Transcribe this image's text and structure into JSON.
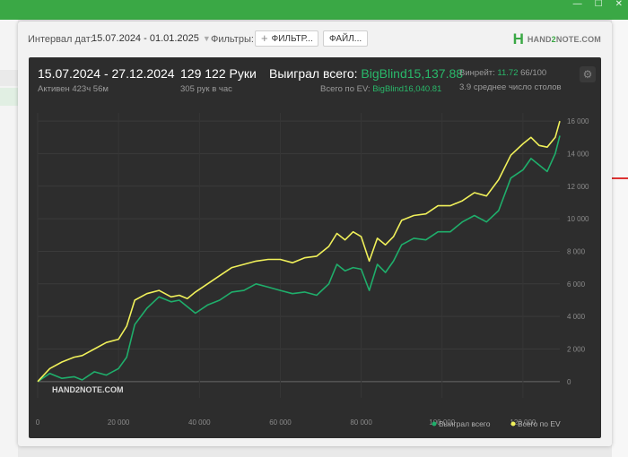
{
  "window": {
    "controls": [
      "—",
      "☐",
      "✕"
    ]
  },
  "filter_bar": {
    "interval_label": "Интервал дат:",
    "interval_value": "15.07.2024 - 01.01.2025",
    "filters_label": "Фильтры:",
    "filter_button": "ФИЛЬТР...",
    "file_button": "ФАЙЛ...",
    "logo_prefix": "HAND",
    "logo_number": "2",
    "logo_suffix": "NOTE.COM"
  },
  "stats": {
    "date_range": "15.07.2024 - 27.12.2024",
    "active": "Активен 423ч 56м",
    "hands": "129 122 Руки",
    "hands_per_hour": "305 рук в час",
    "won_label": "Выиграл всего:",
    "won_value": "BigBlind15,137.88",
    "ev_label": "Всего по EV:",
    "ev_value": "BigBlind16,040.81",
    "winrate_label": "Винрейт:",
    "winrate_value": "11.72",
    "winrate_per": "66/100",
    "avg_tables": "3.9 среднее число столов"
  },
  "chart_data": {
    "type": "line",
    "xlim": [
      0,
      129122
    ],
    "ylim": [
      -1000,
      16500
    ],
    "x_ticks": [
      0,
      20000,
      40000,
      60000,
      80000,
      100000,
      120000
    ],
    "x_tick_labels": [
      "0",
      "20 000",
      "40 000",
      "60 000",
      "80 000",
      "100 000",
      "120 000"
    ],
    "y_ticks": [
      0,
      2000,
      4000,
      6000,
      8000,
      10000,
      12000,
      14000,
      16000
    ],
    "y_tick_labels": [
      "0",
      "2 000",
      "4 000",
      "6 000",
      "8 000",
      "10 000",
      "12 000",
      "14 000",
      "16 000"
    ],
    "grid": true,
    "legend_position": "bottom-right",
    "watermark": "HAND2NOTE.COM",
    "series": [
      {
        "name": "Выиграл всего",
        "color": "#1fae6b",
        "x": [
          0,
          3000,
          6000,
          9000,
          11000,
          14000,
          17000,
          20000,
          22000,
          24000,
          27000,
          30000,
          33000,
          35000,
          37000,
          39000,
          42000,
          45000,
          48000,
          51000,
          54000,
          57000,
          60000,
          63000,
          66000,
          69000,
          72000,
          74000,
          76000,
          78000,
          80000,
          82000,
          84000,
          86000,
          88000,
          90000,
          93000,
          96000,
          99000,
          102000,
          105000,
          108000,
          111000,
          114000,
          117000,
          120000,
          122000,
          124000,
          126000,
          128000,
          129122
        ],
        "y": [
          0,
          500,
          200,
          300,
          100,
          600,
          400,
          800,
          1500,
          3500,
          4500,
          5200,
          4900,
          5000,
          4600,
          4200,
          4700,
          5000,
          5500,
          5600,
          6000,
          5800,
          5600,
          5400,
          5500,
          5300,
          6000,
          7200,
          6800,
          7000,
          6900,
          5600,
          7200,
          6700,
          7400,
          8400,
          8800,
          8700,
          9200,
          9200,
          9800,
          10200,
          9800,
          10500,
          12500,
          13000,
          13700,
          13300,
          12900,
          14000,
          15100
        ]
      },
      {
        "name": "Всего по EV",
        "color": "#f0f05a",
        "x": [
          0,
          3000,
          6000,
          9000,
          11000,
          14000,
          17000,
          20000,
          22000,
          24000,
          27000,
          30000,
          33000,
          35000,
          37000,
          39000,
          42000,
          45000,
          48000,
          51000,
          54000,
          57000,
          60000,
          63000,
          66000,
          69000,
          72000,
          74000,
          76000,
          78000,
          80000,
          82000,
          84000,
          86000,
          88000,
          90000,
          93000,
          96000,
          99000,
          102000,
          105000,
          108000,
          111000,
          114000,
          117000,
          120000,
          122000,
          124000,
          126000,
          128000,
          129122
        ],
        "y": [
          0,
          800,
          1200,
          1500,
          1600,
          2000,
          2400,
          2600,
          3400,
          5000,
          5400,
          5600,
          5200,
          5300,
          5100,
          5500,
          6000,
          6500,
          7000,
          7200,
          7400,
          7500,
          7500,
          7300,
          7600,
          7700,
          8300,
          9100,
          8700,
          9200,
          8900,
          7400,
          8800,
          8400,
          8900,
          9900,
          10200,
          10300,
          10800,
          10800,
          11100,
          11600,
          11400,
          12400,
          13900,
          14600,
          15000,
          14500,
          14400,
          15000,
          16000
        ]
      }
    ]
  }
}
